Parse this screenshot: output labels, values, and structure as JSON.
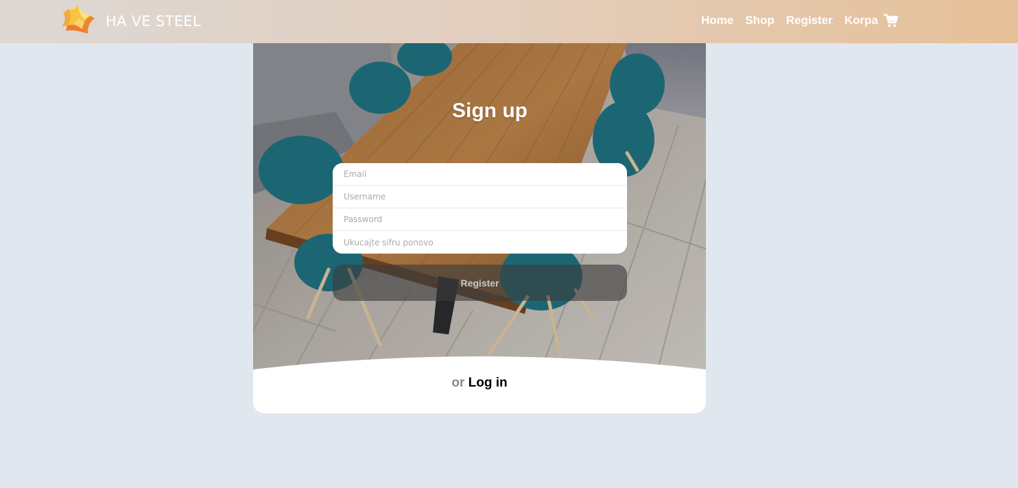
{
  "brand": {
    "name": "HA VE STEEL",
    "logo_icon": "star-cube-logo"
  },
  "nav": {
    "items": [
      {
        "label": "Home"
      },
      {
        "label": "Shop"
      },
      {
        "label": "Register"
      },
      {
        "label": "Korpa"
      }
    ],
    "cart_icon": "cart-icon"
  },
  "signup": {
    "title": "Sign up",
    "fields": {
      "email": {
        "placeholder": "Email",
        "value": ""
      },
      "username": {
        "placeholder": "Username",
        "value": ""
      },
      "password": {
        "placeholder": "Password",
        "value": ""
      },
      "password_repeat": {
        "placeholder": "Ukucajte sifru ponovo",
        "value": ""
      }
    },
    "submit_label": "Register",
    "alt_prefix": "or",
    "alt_link": "Log in"
  },
  "colors": {
    "page_bg": "#e1e7ee",
    "nav_gradient_start": "#ddd8d4",
    "nav_gradient_end": "#e6c098",
    "button_bg": "#3c3c3c"
  }
}
